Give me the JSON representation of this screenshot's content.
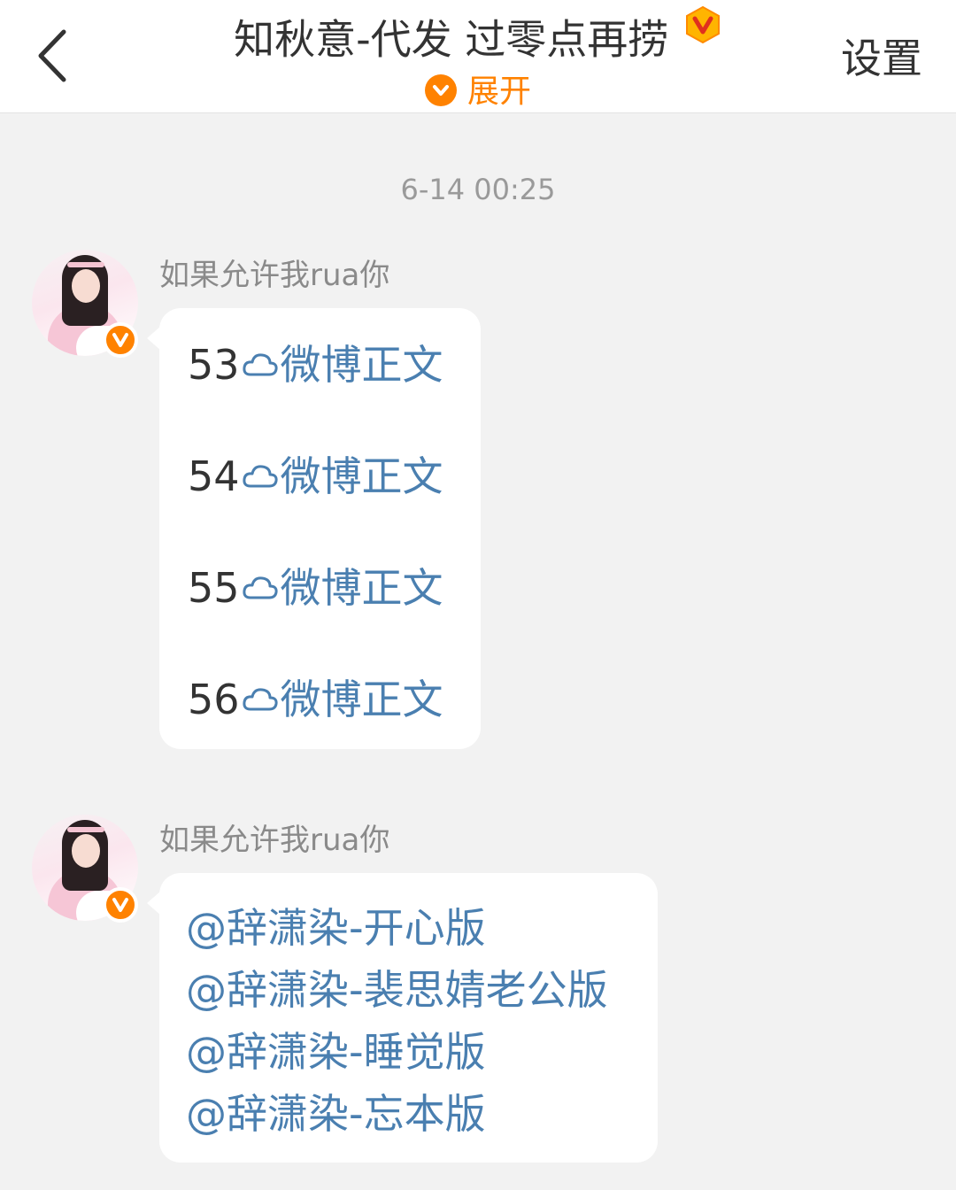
{
  "header": {
    "title": "知秋意-代发 过零点再捞",
    "expand_label": "展开",
    "settings_label": "设置"
  },
  "timestamp": "6-14 00:25",
  "messages": [
    {
      "sender": "如果允许我rua你",
      "items": [
        {
          "num": "53",
          "link": "微博正文"
        },
        {
          "num": "54",
          "link": "微博正文"
        },
        {
          "num": "55",
          "link": "微博正文"
        },
        {
          "num": "56",
          "link": "微博正文"
        }
      ]
    },
    {
      "sender": "如果允许我rua你",
      "mentions": [
        "@辞潇染-开心版",
        "@辞潇染-裴思婧老公版",
        "@辞潇染-睡觉版",
        "@辞潇染-忘本版"
      ]
    }
  ],
  "colors": {
    "accent": "#ff8200",
    "link": "#4a7fb0",
    "background": "#f2f2f2"
  },
  "icons": [
    "back-arrow-icon",
    "verified-v-icon",
    "chevron-down-icon",
    "cloud-link-icon"
  ]
}
